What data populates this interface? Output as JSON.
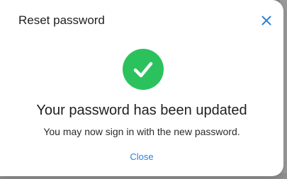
{
  "dialog": {
    "title": "Reset password",
    "close_icon": "close-icon",
    "status_icon": "check-circle-icon",
    "headline": "Your password has been updated",
    "message": "You may now sign in with the new password.",
    "close_label": "Close"
  },
  "colors": {
    "accent": "#2f7fd8",
    "success": "#2bc25e",
    "text": "#1f1f1f"
  }
}
